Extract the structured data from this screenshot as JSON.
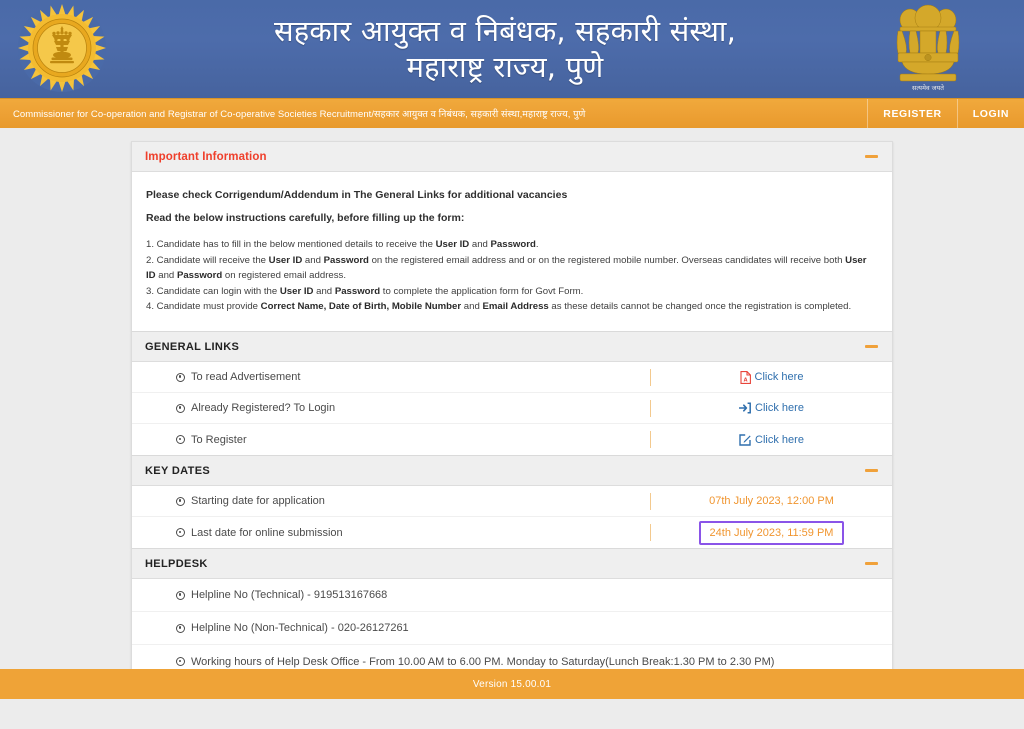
{
  "header": {
    "title_line1": "सहकार आयुक्त व निबंधक, सहकारी संस्था,",
    "title_line2": "महाराष्ट्र राज्य, पुणे",
    "left_emblem_name": "maharashtra-state-emblem",
    "right_emblem_name": "ashoka-lion-capital-emblem",
    "right_emblem_caption": "सत्यमेव जयते"
  },
  "navbar": {
    "brand": "Commissioner for Co-operation and Registrar of Co-operative Societies Recruitment/सहकार आयुक्त व निबंधक, सहकारी संस्था,महाराष्ट्र राज्य, पुणे",
    "register_label": "REGISTER",
    "login_label": "LOGIN"
  },
  "important_information": {
    "title": "Important Information",
    "lead1": "Please check Corrigendum/Addendum in The General Links for additional vacancies",
    "lead2": "Read the below instructions carefully, before filling up the form:",
    "items": [
      "1. Candidate has to fill in the below mentioned details to receive the <b>User ID</b> and <b>Password</b>.",
      "2. Candidate will receive the <b>User ID</b> and <b>Password</b> on the registered email address and or on the registered mobile number. Overseas candidates will receive both <b>User ID</b> and <b>Password</b> on registered email address.",
      "3. Candidate can login with the <b>User ID</b> and <b>Password</b> to complete the application form for Govt Form.",
      "4. Candidate must provide <b>Correct Name, Date of Birth, Mobile Number</b> and <b>Email Address</b> as these details cannot be changed once the registration is completed."
    ]
  },
  "general_links": {
    "title": "GENERAL LINKS",
    "rows": [
      {
        "label": "To read Advertisement",
        "link_text": "Click here",
        "icon": "pdf-file-icon",
        "icon_color": "#e8443a"
      },
      {
        "label": "Already Registered? To Login",
        "link_text": "Click here",
        "icon": "sign-in-icon",
        "icon_color": "#2f6fad"
      },
      {
        "label": "To Register",
        "link_text": "Click here",
        "icon": "edit-square-icon",
        "icon_color": "#2f6fad"
      }
    ]
  },
  "key_dates": {
    "title": "KEY DATES",
    "rows": [
      {
        "label": "Starting date for application",
        "value": "07th July 2023, 12:00 PM",
        "highlighted": false
      },
      {
        "label": "Last date for online submission",
        "value": "24th July 2023, 11:59 PM",
        "highlighted": true
      }
    ]
  },
  "helpdesk": {
    "title": "HELPDESK",
    "rows": [
      {
        "label": "Helpline No (Technical) - 919513167668"
      },
      {
        "label": "Helpline No (Non-Technical) - 020-26127261"
      },
      {
        "label": "Working hours of Help Desk Office - From 10.00 AM to 6.00 PM. Monday to Saturday(Lunch Break:1.30 PM to 2.30 PM)"
      }
    ]
  },
  "footer": {
    "version": "Version 15.00.01"
  },
  "colors": {
    "banner_blue": "#4a6aa8",
    "accent_orange": "#efa337",
    "link_blue": "#2f6fad",
    "title_red": "#ef3f2b",
    "date_orange": "#f0952f",
    "highlight_purple": "#8a54e8"
  }
}
